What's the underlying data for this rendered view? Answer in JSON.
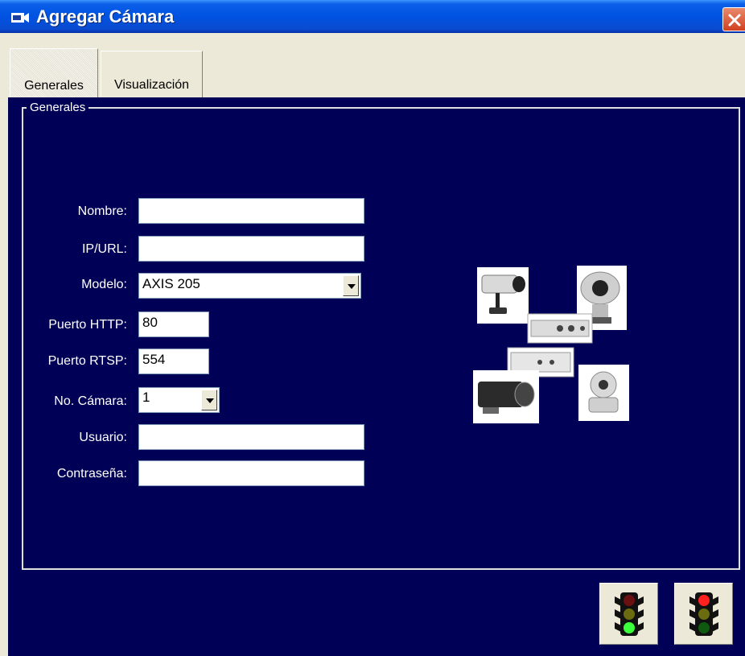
{
  "window": {
    "title": "Agregar Cámara",
    "close_icon": "close-icon"
  },
  "tabs": [
    {
      "label": "Generales",
      "active": true
    },
    {
      "label": "Visualización",
      "active": false
    }
  ],
  "group": {
    "legend": "Generales"
  },
  "form": {
    "nombre": {
      "label": "Nombre:",
      "value": ""
    },
    "ip_url": {
      "label": "IP/URL:",
      "value": ""
    },
    "modelo": {
      "label": "Modelo:",
      "value": "AXIS 205"
    },
    "puerto_http": {
      "label": "Puerto HTTP:",
      "value": "80"
    },
    "puerto_rtsp": {
      "label": "Puerto RTSP:",
      "value": "554"
    },
    "no_camara": {
      "label": "No. Cámara:",
      "value": "1"
    },
    "usuario": {
      "label": "Usuario:",
      "value": ""
    },
    "contrasena": {
      "label": "Contraseña:",
      "value": ""
    }
  },
  "buttons": {
    "accept_icon": "traffic-light-green-icon",
    "cancel_icon": "traffic-light-red-icon"
  },
  "colors": {
    "panel_bg": "#000056",
    "titlebar": "#0053e1",
    "window_bg": "#ECE9D8"
  }
}
